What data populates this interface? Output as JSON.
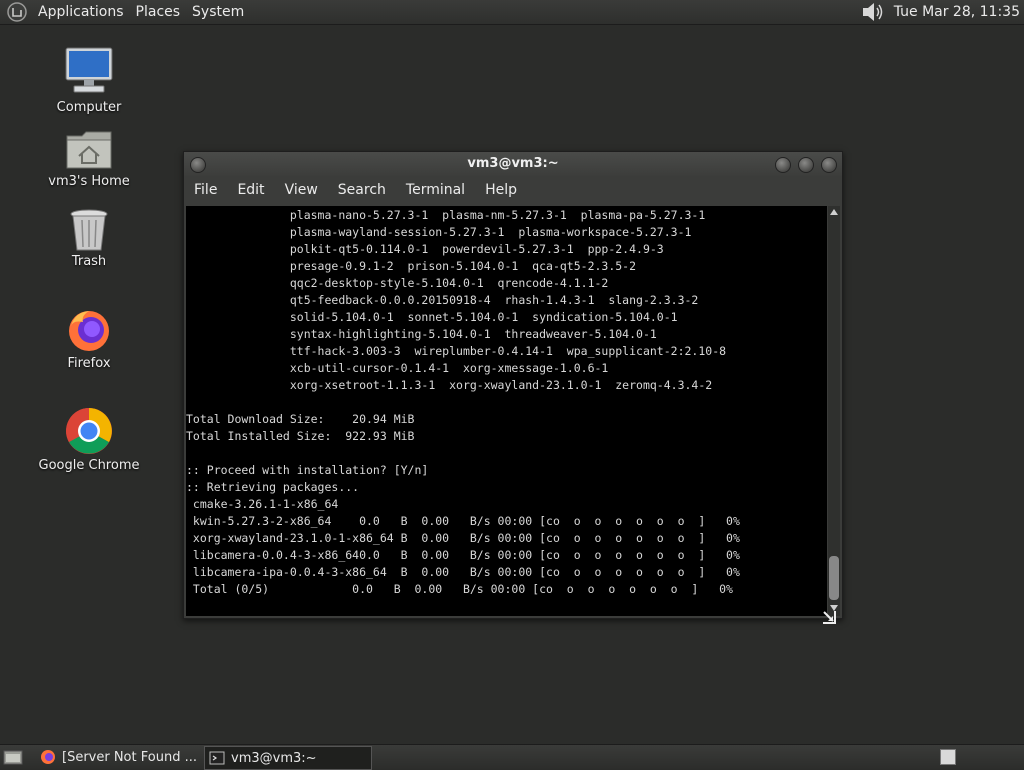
{
  "top_panel": {
    "menus": [
      "Applications",
      "Places",
      "System"
    ],
    "clock": "Tue Mar 28, 11:35"
  },
  "desktop_icons": {
    "computer": "Computer",
    "home": "vm3's Home",
    "trash": "Trash",
    "firefox": "Firefox",
    "chrome": "Google Chrome"
  },
  "terminal": {
    "title": "vm3@vm3:~",
    "menu": [
      "File",
      "Edit",
      "View",
      "Search",
      "Terminal",
      "Help"
    ],
    "lines": [
      "               plasma-nano-5.27.3-1  plasma-nm-5.27.3-1  plasma-pa-5.27.3-1",
      "               plasma-wayland-session-5.27.3-1  plasma-workspace-5.27.3-1",
      "               polkit-qt5-0.114.0-1  powerdevil-5.27.3-1  ppp-2.4.9-3",
      "               presage-0.9.1-2  prison-5.104.0-1  qca-qt5-2.3.5-2",
      "               qqc2-desktop-style-5.104.0-1  qrencode-4.1.1-2",
      "               qt5-feedback-0.0.0.20150918-4  rhash-1.4.3-1  slang-2.3.3-2",
      "               solid-5.104.0-1  sonnet-5.104.0-1  syndication-5.104.0-1",
      "               syntax-highlighting-5.104.0-1  threadweaver-5.104.0-1",
      "               ttf-hack-3.003-3  wireplumber-0.4.14-1  wpa_supplicant-2:2.10-8",
      "               xcb-util-cursor-0.1.4-1  xorg-xmessage-1.0.6-1",
      "               xorg-xsetroot-1.1.3-1  xorg-xwayland-23.1.0-1  zeromq-4.3.4-2",
      "",
      "Total Download Size:    20.94 MiB",
      "Total Installed Size:  922.93 MiB",
      "",
      ":: Proceed with installation? [Y/n]",
      ":: Retrieving packages...",
      " cmake-3.26.1-1-x86_64",
      " kwin-5.27.3-2-x86_64    0.0   B  0.00   B/s 00:00 [co  o  o  o  o  o  o  ]   0%",
      " xorg-xwayland-23.1.0-1-x86_64 B  0.00   B/s 00:00 [co  o  o  o  o  o  o  ]   0%",
      " libcamera-0.0.4-3-x86_640.0   B  0.00   B/s 00:00 [co  o  o  o  o  o  o  ]   0%",
      " libcamera-ipa-0.0.4-3-x86_64  B  0.00   B/s 00:00 [co  o  o  o  o  o  o  ]   0%",
      " Total (0/5)            0.0   B  0.00   B/s 00:00 [co  o  o  o  o  o  o  ]   0%"
    ]
  },
  "taskbar": {
    "tasks": [
      "[Server Not Found ...",
      "vm3@vm3:~"
    ]
  }
}
